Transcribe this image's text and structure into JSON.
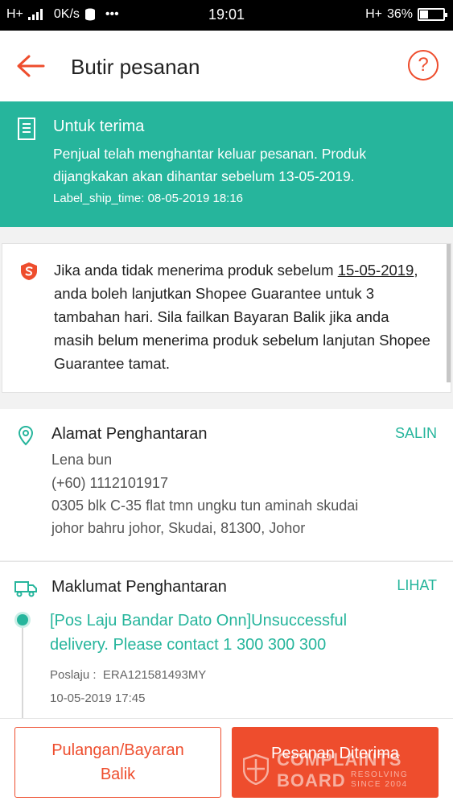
{
  "status_bar": {
    "network": "H+",
    "speed": "0K/s",
    "dots": "•••",
    "time": "19:01",
    "network_right": "H+",
    "battery": "36%",
    "battery_level": 0.36
  },
  "header": {
    "title": "Butir pesanan",
    "help_symbol": "?"
  },
  "status_banner": {
    "heading": "Untuk terima",
    "description": "Penjual telah menghantar keluar pesanan. Produk dijangkakan akan dihantar sebelum 13-05-2019.",
    "ship_time": "Label_ship_time: 08-05-2019 18:16"
  },
  "guarantee": {
    "text_before": "Jika anda tidak menerima produk sebelum ",
    "date": "15-05-2019",
    "text_after": ", anda boleh lanjutkan Shopee Guarantee untuk 3 tambahan hari. Sila failkan Bayaran Balik jika anda masih belum menerima produk sebelum lanjutan Shopee Guarantee tamat."
  },
  "address": {
    "title": "Alamat Penghantaran",
    "action": "SALIN",
    "name": "Lena bun",
    "phone": "(+60) 1112101917",
    "line1": "0305 blk C-35 flat tmn ungku tun aminah skudai",
    "line2": "johor bahru johor, Skudai, 81300, Johor"
  },
  "shipping": {
    "title": "Maklumat Penghantaran",
    "action": "LIHAT",
    "latest_status": "[Pos Laju Bandar Dato Onn]Unsuccessful delivery. Please contact 1 300 300 300",
    "tracking_label": "Poslaju :",
    "tracking_number": "ERA121581493MY",
    "timestamp": "10-05-2019 17:45"
  },
  "buttons": {
    "return_line1": "Pulangan/Bayaran",
    "return_line2": "Balik",
    "received": "Pesanan Diterima"
  },
  "watermark": {
    "line1": "COMPLAINTS",
    "line2": "BOARD",
    "sub1": "RESOLVING",
    "sub2": "SINCE 2004"
  },
  "colors": {
    "brand": "#ee4d2d",
    "accent": "#26b59c"
  }
}
